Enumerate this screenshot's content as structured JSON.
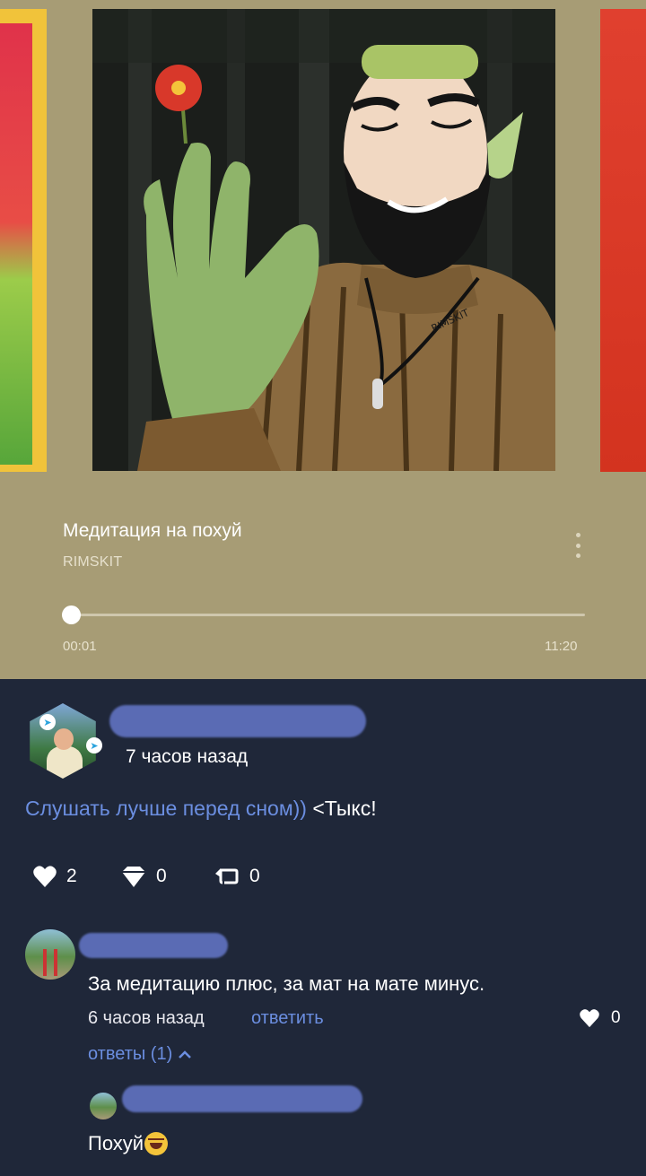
{
  "player": {
    "track_title": "Медитация на похуй",
    "artist": "RIMSKIT",
    "current_time": "00:01",
    "total_time": "11:20",
    "progress_fraction": 0.0015,
    "cover_signature": "RIMSKIT"
  },
  "post": {
    "time": "7 часов назад",
    "text_link": "Слушать лучше перед сном))",
    "text_tail": " <Тыкс!",
    "likes": "2",
    "dislikes": "0",
    "reposts": "0"
  },
  "comment": {
    "text": "За медитацию плюс, за мат на мате минус.",
    "time": "6 часов назад",
    "reply_label": "ответить",
    "likes": "0",
    "replies_label": "ответы (1)"
  },
  "reply": {
    "text": "Похуй"
  },
  "colors": {
    "player_bg": "#a79c75",
    "page_bg": "#1f2739",
    "link": "#6b8ee0"
  },
  "icons": [
    "more-vertical-icon",
    "heart-icon",
    "dislike-icon",
    "repost-icon",
    "chevron-up-icon",
    "telegram-icon",
    "rofl-emoji-icon"
  ]
}
